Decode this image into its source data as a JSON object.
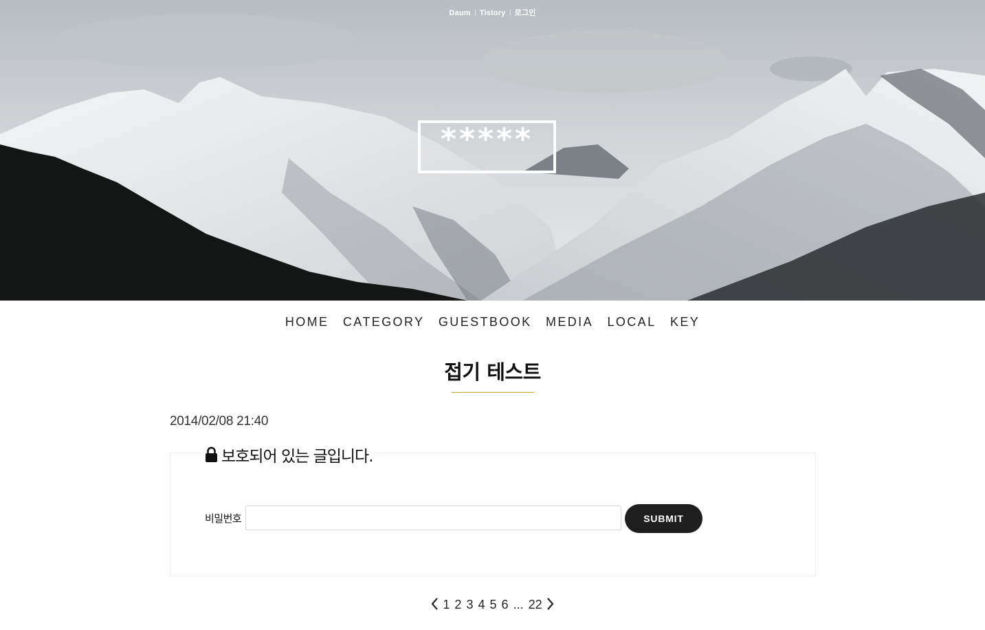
{
  "header": {
    "links": [
      "Daum",
      "Tistory",
      "로그인"
    ],
    "logo_text": "*****"
  },
  "nav": {
    "items": [
      "HOME",
      "CATEGORY",
      "GUESTBOOK",
      "MEDIA",
      "LOCAL",
      "KEY"
    ]
  },
  "post": {
    "title": "접기 테스트",
    "date": "2014/02/08 21:40",
    "protected_message": "보호되어 있는 글입니다.",
    "password_label": "비밀번호",
    "password_value": "",
    "submit_label": "SUBMIT"
  },
  "pagination": {
    "pages": [
      "1",
      "2",
      "3",
      "4",
      "5",
      "6"
    ],
    "ellipsis": "...",
    "last_page": "22"
  },
  "colors": {
    "title_rule": "#c9a227",
    "button_bg": "#1e1e1e"
  },
  "icons": {
    "lock": "lock-icon",
    "prev": "chevron-left-icon",
    "next": "chevron-right-icon"
  }
}
